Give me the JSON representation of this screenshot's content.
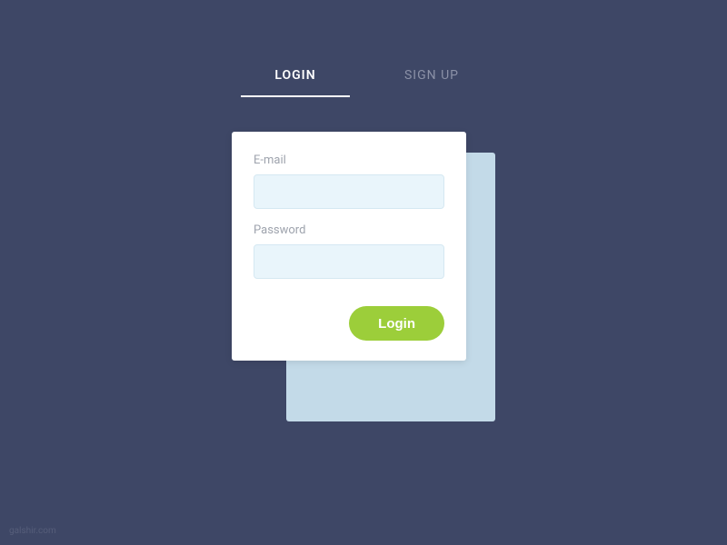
{
  "tabs": {
    "login": "LOGIN",
    "signup": "SIGN UP"
  },
  "form": {
    "email_label": "E-mail",
    "password_label": "Password",
    "email_value": "",
    "password_value": "",
    "submit_label": "Login"
  },
  "footer": {
    "credit": "galshir.com"
  }
}
